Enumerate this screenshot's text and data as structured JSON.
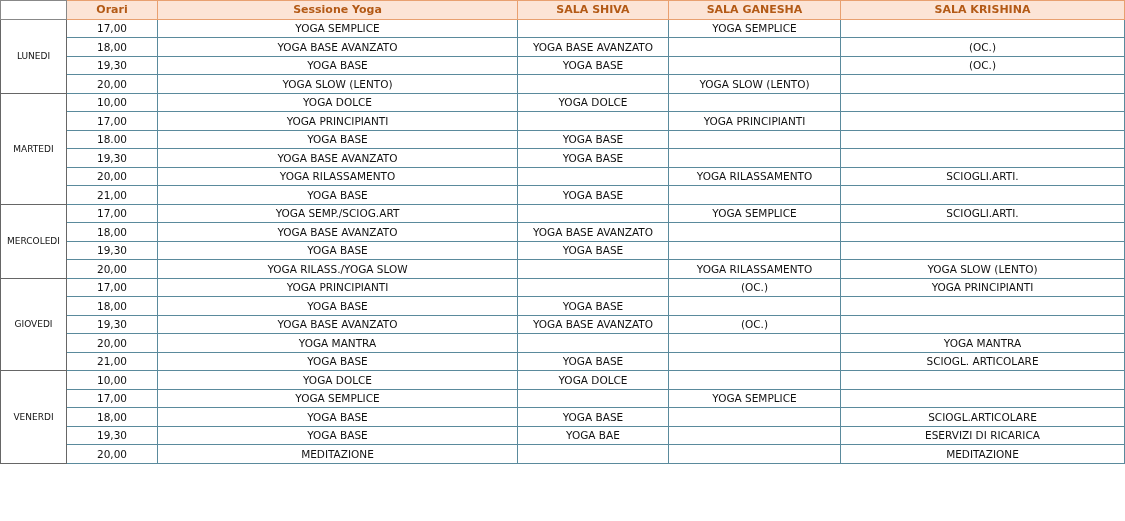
{
  "table": {
    "columns": [
      "Orari",
      "Sessione Yoga",
      "SALA SHIVA",
      "SALA GANESHA",
      "SALA KRISHINA"
    ],
    "days": [
      {
        "day": "LUNEDI",
        "rows": [
          {
            "time": "17,00",
            "session": "YOGA SEMPLICE",
            "ganesha": "YOGA SEMPLICE"
          },
          {
            "time": "18,00",
            "session": "YOGA BASE AVANZATO",
            "shiva": "YOGA BASE AVANZATO",
            "krishina": "(OC.)"
          },
          {
            "time": "19,30",
            "session": "YOGA BASE",
            "shiva": "YOGA BASE",
            "krishina": "(OC.)"
          },
          {
            "time": "20,00",
            "session": "YOGA SLOW (LENTO)",
            "ganesha": "YOGA SLOW (LENTO)"
          }
        ]
      },
      {
        "day": "MARTEDI",
        "rows": [
          {
            "time": "10,00",
            "session": "YOGA DOLCE",
            "shiva": "YOGA DOLCE"
          },
          {
            "time": "17,00",
            "session": "YOGA PRINCIPIANTI",
            "ganesha": "YOGA PRINCIPIANTI"
          },
          {
            "time": "18.00",
            "session": "YOGA BASE",
            "shiva": "YOGA BASE"
          },
          {
            "time": "19,30",
            "session": "YOGA BASE AVANZATO",
            "shiva": "YOGA BASE"
          },
          {
            "time": "20,00",
            "session": "YOGA RILASSAMENTO",
            "ganesha": "YOGA RILASSAMENTO",
            "krishina": "SCIOGLI.ARTI."
          },
          {
            "time": "21,00",
            "session": "YOGA BASE",
            "shiva": "YOGA BASE"
          }
        ]
      },
      {
        "day": "MERCOLEDI",
        "rows": [
          {
            "time": "17,00",
            "session": "YOGA SEMP./SCIOG.ART",
            "ganesha": "YOGA SEMPLICE",
            "krishina": "SCIOGLI.ARTI."
          },
          {
            "time": "18,00",
            "session": "YOGA BASE AVANZATO",
            "shiva": "YOGA BASE AVANZATO"
          },
          {
            "time": "19,30",
            "session": "YOGA BASE",
            "shiva": "YOGA BASE"
          },
          {
            "time": "20,00",
            "session": "YOGA RILASS./YOGA SLOW",
            "ganesha": "YOGA RILASSAMENTO",
            "krishina": "YOGA SLOW (LENTO)"
          }
        ]
      },
      {
        "day": "GIOVEDI",
        "rows": [
          {
            "time": "17,00",
            "session": "YOGA PRINCIPIANTI",
            "ganesha": "(OC.)",
            "krishina": "YOGA PRINCIPIANTI"
          },
          {
            "time": "18,00",
            "session": "YOGA BASE",
            "shiva": "YOGA BASE"
          },
          {
            "time": "19,30",
            "session": "YOGA BASE AVANZATO",
            "shiva": "YOGA BASE AVANZATO",
            "ganesha": "(OC.)"
          },
          {
            "time": "20,00",
            "session": "YOGA MANTRA",
            "krishina": "YOGA MANTRA"
          },
          {
            "time": "21,00",
            "session": "YOGA BASE",
            "shiva": "YOGA BASE",
            "krishina": "SCIOGL. ARTICOLARE"
          }
        ]
      },
      {
        "day": "VENERDI",
        "rows": [
          {
            "time": "10,00",
            "session": "YOGA DOLCE",
            "shiva": "YOGA DOLCE"
          },
          {
            "time": "17,00",
            "session": "YOGA SEMPLICE",
            "ganesha": "YOGA SEMPLICE"
          },
          {
            "time": "18,00",
            "session": "YOGA BASE",
            "shiva": "YOGA BASE",
            "krishina": "SCIOGL.ARTICOLARE"
          },
          {
            "time": "19,30",
            "session": "YOGA BASE",
            "shiva": "YOGA BAE",
            "krishina": "ESERVIZI DI RICARICA"
          },
          {
            "time": "20,00",
            "session": "MEDITAZIONE",
            "krishina": "MEDITAZIONE"
          }
        ]
      }
    ]
  }
}
